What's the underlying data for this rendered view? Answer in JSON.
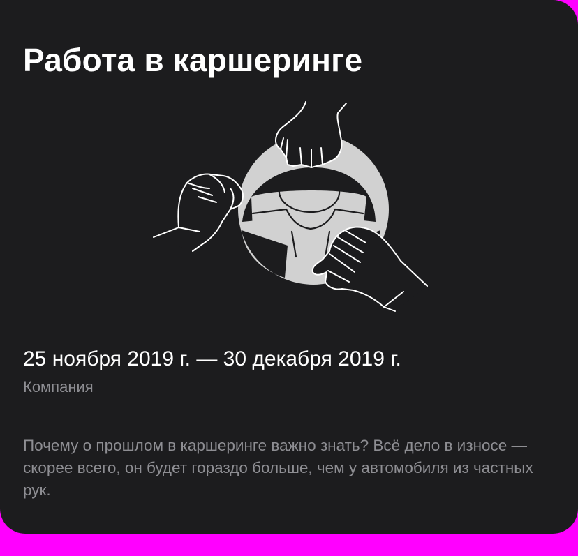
{
  "card": {
    "title": "Работа в каршеринге",
    "illustration_icon": "steering-wheel-with-hands-icon",
    "dates": "25 ноября 2019 г. — 30 декабря 2019 г.",
    "kind": "Компания",
    "description": "Почему о прошлом в каршеринге важно знать? Всё дело в износе — скорее всего, он будет гораздо больше, чем у автомобиля из частных рук."
  },
  "colors": {
    "card_background": "#1c1c1e",
    "page_background": "#ff00ff",
    "title": "#ffffff",
    "secondary_text": "#8e8e93",
    "wheel": "#d1d1d1",
    "hand_outline": "#ffffff"
  }
}
